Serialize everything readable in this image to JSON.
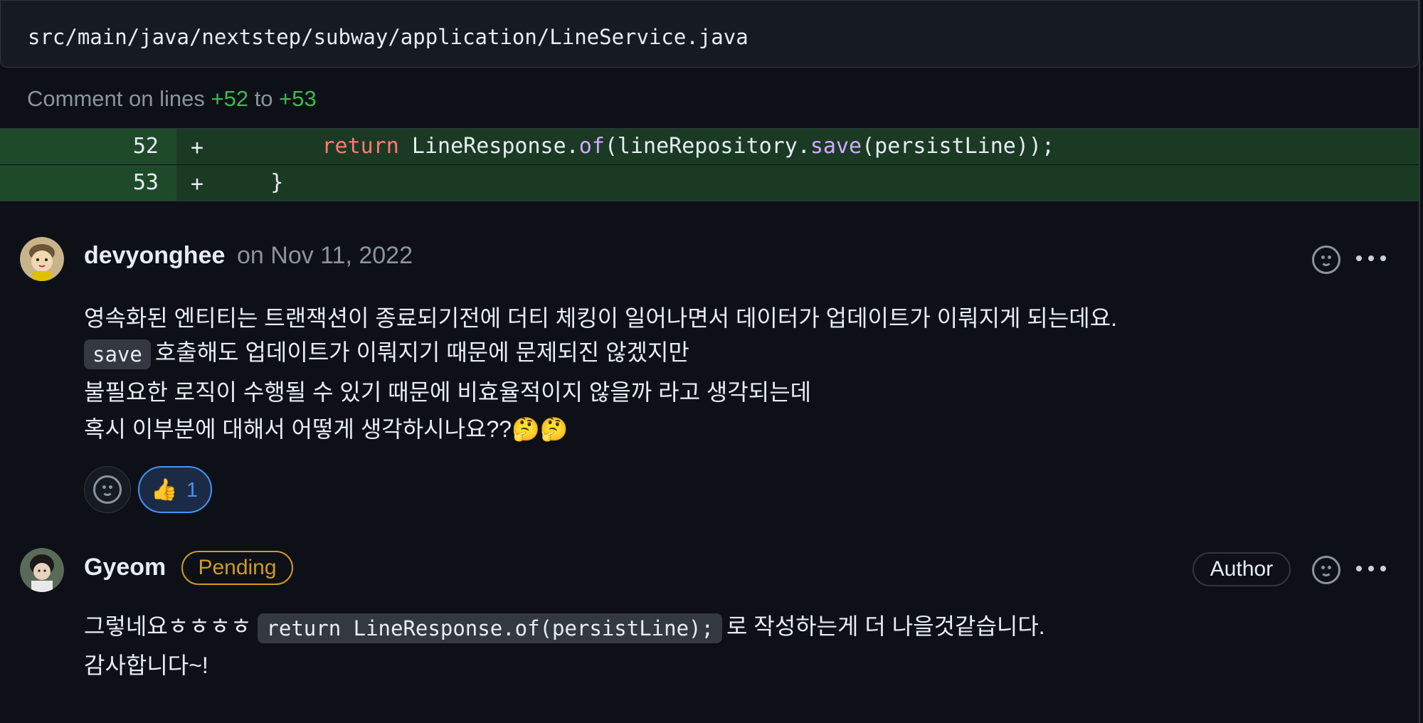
{
  "file": {
    "path": "src/main/java/nextstep/subway/application/LineService.java"
  },
  "comment_range": {
    "prefix": "Comment on lines",
    "start": "+52",
    "middle": "to",
    "end": "+53"
  },
  "diff": {
    "rows": [
      {
        "line": "52",
        "sign": "+",
        "kw": "return",
        "a": " LineResponse.",
        "f1": "of",
        "b": "(lineRepository.",
        "f2": "save",
        "c": "(persistLine));"
      },
      {
        "line": "53",
        "sign": "+",
        "code": "}"
      }
    ]
  },
  "comments": [
    {
      "author": "devyonghee",
      "date": "on Nov 11, 2022",
      "body": {
        "line1": "영속화된 엔티티는 트랜잭션이 종료되기전에 더티 체킹이 일어나면서 데이터가 업데이트가 이뤄지게 되는데요.",
        "line2_code": "save",
        "line2_text": "호출해도 업데이트가 이뤄지기 때문에 문제되진 않겠지만",
        "line3": "불필요한 로직이 수행될 수 있기 때문에 비효율적이지 않을까 라고 생각되는데",
        "line4": "혹시 이부분에 대해서 어떻게 생각하시나요??🤔🤔"
      },
      "reactions": [
        {
          "emoji": "👍",
          "count": "1"
        }
      ]
    },
    {
      "author": "Gyeom",
      "status": "Pending",
      "badge": "Author",
      "body": {
        "line1_pre": "그렇네요ㅎㅎㅎㅎ",
        "line1_code": "return LineResponse.of(persistLine);",
        "line1_post": "로 작성하는게 더 나을것같습니다.",
        "line2": "감사합니다~!"
      }
    }
  ],
  "colors": {
    "background": "#0d1117",
    "added_line": "#1b3a24",
    "pending": "#d29922",
    "reaction_active": "#4493f8"
  }
}
